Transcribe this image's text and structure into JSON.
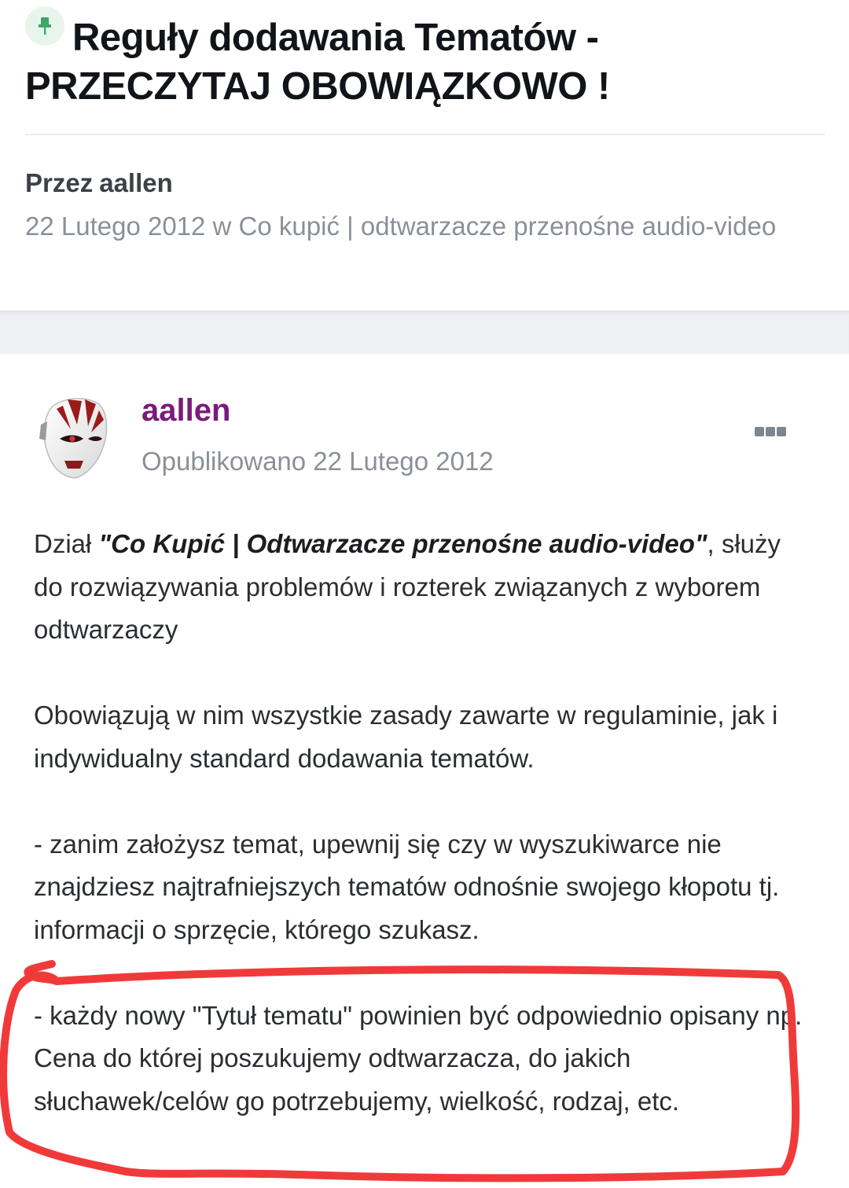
{
  "topic": {
    "title": "Reguły dodawania Tematów - PRZECZYTAJ OBOWIĄZKOWO !",
    "icon": "pin-icon",
    "byline_prefix": "Przez",
    "author": "aallen",
    "meta": "22 Lutego 2012 w Co kupić | odtwarzacze przenośne audio-video"
  },
  "post": {
    "author": "aallen",
    "posted": "Opublikowano 22 Lutego 2012",
    "menu_icon": "more-options-icon",
    "author_color": "#7a1a7a",
    "paragraphs": [
      {
        "prefix": "Dział ",
        "emphasis": "\"Co Kupić | Odtwarzacze przenośne audio-video\"",
        "suffix": ", służy do rozwiązywania problemów i rozterek związanych z wyborem odtwarzaczy"
      },
      {
        "text": "Obowiązują w nim wszystkie zasady zawarte w regulaminie, jak i indywidualny standard dodawania tematów."
      },
      {
        "text": "- zanim założysz temat, upewnij się czy w wyszukiwarce nie znajdziesz najtrafniejszych tematów odnośnie swojego kłopotu tj. informacji o sprzęcie, którego szukasz."
      },
      {
        "text": "- każdy nowy \"Tytuł tematu\" powinien być odpowiednio opisany np. Cena do której poszukujemy odtwarzacza, do jakich słuchawek/celów go potrzebujemy, wielkość, rodzaj, etc."
      }
    ]
  },
  "annotation": {
    "color": "#f03a3a"
  }
}
